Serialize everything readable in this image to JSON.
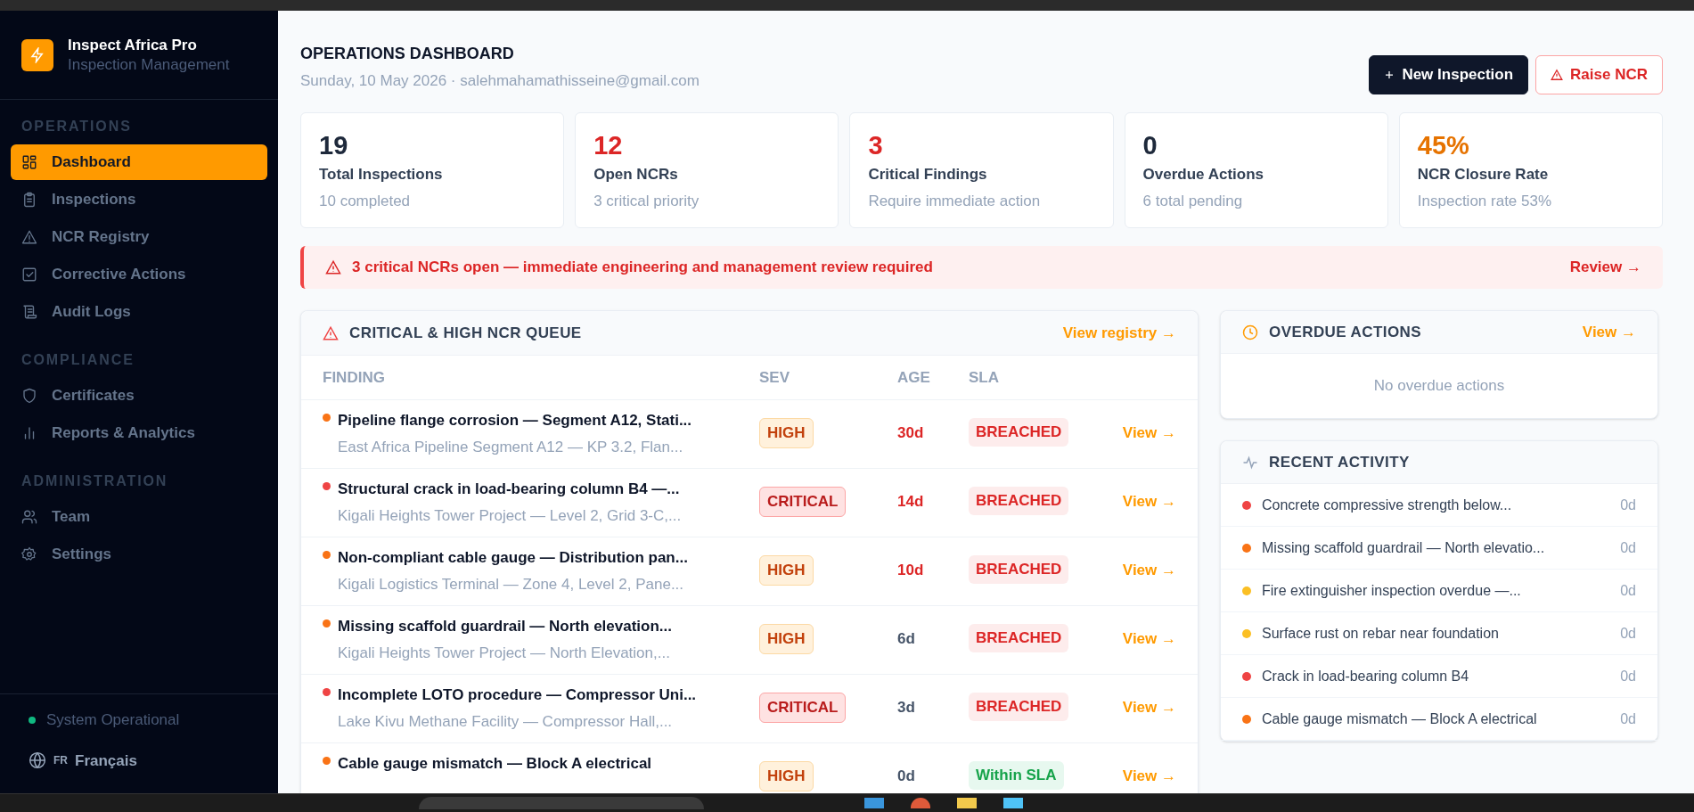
{
  "sidebar": {
    "brand": {
      "name": "Inspect Africa Pro",
      "subtitle": "Inspection Management"
    },
    "sections": [
      {
        "title": "OPERATIONS",
        "items": [
          {
            "label": "Dashboard",
            "selected": true
          },
          {
            "label": "Inspections",
            "selected": false
          },
          {
            "label": "NCR Registry",
            "selected": false
          },
          {
            "label": "Corrective Actions",
            "selected": false
          },
          {
            "label": "Audit Logs",
            "selected": false
          }
        ]
      },
      {
        "title": "COMPLIANCE",
        "items": [
          {
            "label": "Certificates",
            "selected": false
          },
          {
            "label": "Reports & Analytics",
            "selected": false
          }
        ]
      },
      {
        "title": "ADMINISTRATION",
        "items": [
          {
            "label": "Team",
            "selected": false
          },
          {
            "label": "Settings",
            "selected": false
          }
        ]
      }
    ],
    "status": {
      "label": "System Operational",
      "color": "#10b981"
    },
    "language": {
      "code": "FR",
      "label": "Français"
    }
  },
  "header": {
    "title": "OPERATIONS DASHBOARD",
    "subtitle": "Sunday, 10 May 2026 · salehmahamathisseine@gmail.com",
    "buttons": [
      {
        "label": "New Inspection",
        "kind": "primary"
      },
      {
        "label": "Raise NCR",
        "kind": "danger"
      }
    ]
  },
  "stats": [
    {
      "value": "19",
      "label": "Total Inspections",
      "detail": "10 completed",
      "color": "#1e293b"
    },
    {
      "value": "12",
      "label": "Open NCRs",
      "detail": "3 critical priority",
      "color": "#dc2626"
    },
    {
      "value": "3",
      "label": "Critical Findings",
      "detail": "Require immediate action",
      "color": "#dc2626"
    },
    {
      "value": "0",
      "label": "Overdue Actions",
      "detail": "6 total pending",
      "color": "#1e293b"
    },
    {
      "value": "45%",
      "label": "NCR Closure Rate",
      "detail": "Inspection rate 53%",
      "color": "#e67300"
    }
  ],
  "alert": {
    "message": "3 critical NCRs open — immediate engineering and management review required",
    "action": "Review →"
  },
  "ncr_queue": {
    "title": "CRITICAL & HIGH NCR QUEUE",
    "link": "View registry →",
    "columns": [
      "FINDING",
      "SEV",
      "AGE",
      "SLA"
    ],
    "rows": [
      {
        "title": "Pipeline flange corrosion — Segment A12, Stati...",
        "location": "East Africa Pipeline Segment A12 — KP 3.2, Flan...",
        "color": "#f97316",
        "severity": "HIGH",
        "kind": "high",
        "age": "30d",
        "age_alert": true,
        "sla": "BREACHED",
        "breached": true,
        "action": "View →"
      },
      {
        "title": "Structural crack in load-bearing column B4 —...",
        "location": "Kigali Heights Tower Project — Level 2, Grid 3-C,...",
        "color": "#ef4444",
        "severity": "CRITICAL",
        "kind": "critical",
        "age": "14d",
        "age_alert": true,
        "sla": "BREACHED",
        "breached": true,
        "action": "View →"
      },
      {
        "title": "Non-compliant cable gauge — Distribution pan...",
        "location": "Kigali Logistics Terminal — Zone 4, Level 2, Pane...",
        "color": "#f97316",
        "severity": "HIGH",
        "kind": "high",
        "age": "10d",
        "age_alert": true,
        "sla": "BREACHED",
        "breached": true,
        "action": "View →"
      },
      {
        "title": "Missing scaffold guardrail — North elevation...",
        "location": "Kigali Heights Tower Project — North Elevation,...",
        "color": "#f97316",
        "severity": "HIGH",
        "kind": "high",
        "age": "6d",
        "age_alert": false,
        "sla": "BREACHED",
        "breached": true,
        "action": "View →"
      },
      {
        "title": "Incomplete LOTO procedure — Compressor Uni...",
        "location": "Lake Kivu Methane Facility — Compressor Hall,...",
        "color": "#ef4444",
        "severity": "CRITICAL",
        "kind": "critical",
        "age": "3d",
        "age_alert": false,
        "sla": "BREACHED",
        "breached": true,
        "action": "View →"
      },
      {
        "title": "Cable gauge mismatch — Block A electrical",
        "color": "#f97316",
        "severity": "HIGH",
        "kind": "high",
        "age": "0d",
        "age_alert": false,
        "sla": "Within SLA",
        "breached": false,
        "action": "View →"
      }
    ]
  },
  "overdue": {
    "title": "OVERDUE ACTIONS",
    "link": "View →",
    "empty": "No overdue actions"
  },
  "activity": {
    "title": "RECENT ACTIVITY",
    "items": [
      {
        "text": "Concrete compressive strength below...",
        "color": "#ef4444",
        "age": "0d"
      },
      {
        "text": "Missing scaffold guardrail — North elevatio...",
        "color": "#f97316",
        "age": "0d"
      },
      {
        "text": "Fire extinguisher inspection overdue —...",
        "color": "#fbbf24",
        "age": "0d"
      },
      {
        "text": "Surface rust on rebar near foundation",
        "color": "#fbbf24",
        "age": "0d"
      },
      {
        "text": "Crack in load-bearing column B4",
        "color": "#ef4444",
        "age": "0d"
      },
      {
        "text": "Cable gauge mismatch — Block A electrical",
        "color": "#f97316",
        "age": "0d"
      }
    ]
  }
}
